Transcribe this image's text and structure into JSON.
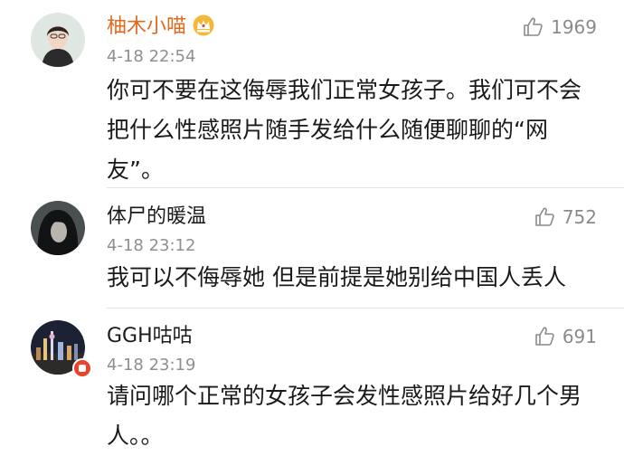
{
  "comments": [
    {
      "name": "柚木小喵",
      "vip": true,
      "time": "4-18 22:54",
      "likes": "1969",
      "text": "你可不要在这侮辱我们正常女孩子。我们可不会把什么性感照片随手发给什么随便聊聊的“网友”。",
      "avatar_icon": "woman-portrait-avatar",
      "name_color": "#e06a1c"
    },
    {
      "name": "体尸的暖温",
      "vip": false,
      "time": "4-18 23:12",
      "likes": "752",
      "text": "我可以不侮辱她 但是前提是她别给中国人丢人",
      "avatar_icon": "dark-hair-avatar"
    },
    {
      "name": "GGH咕咕",
      "vip": false,
      "time": "4-18 23:19",
      "likes": "691",
      "text": "请问哪个正常的女孩子会发性感照片给好几个男人。。",
      "avatar_icon": "city-skyline-avatar"
    }
  ],
  "colors": {
    "time": "#8f8f8f",
    "like": "#8a8a8a",
    "divider": "#e6e6e6"
  }
}
